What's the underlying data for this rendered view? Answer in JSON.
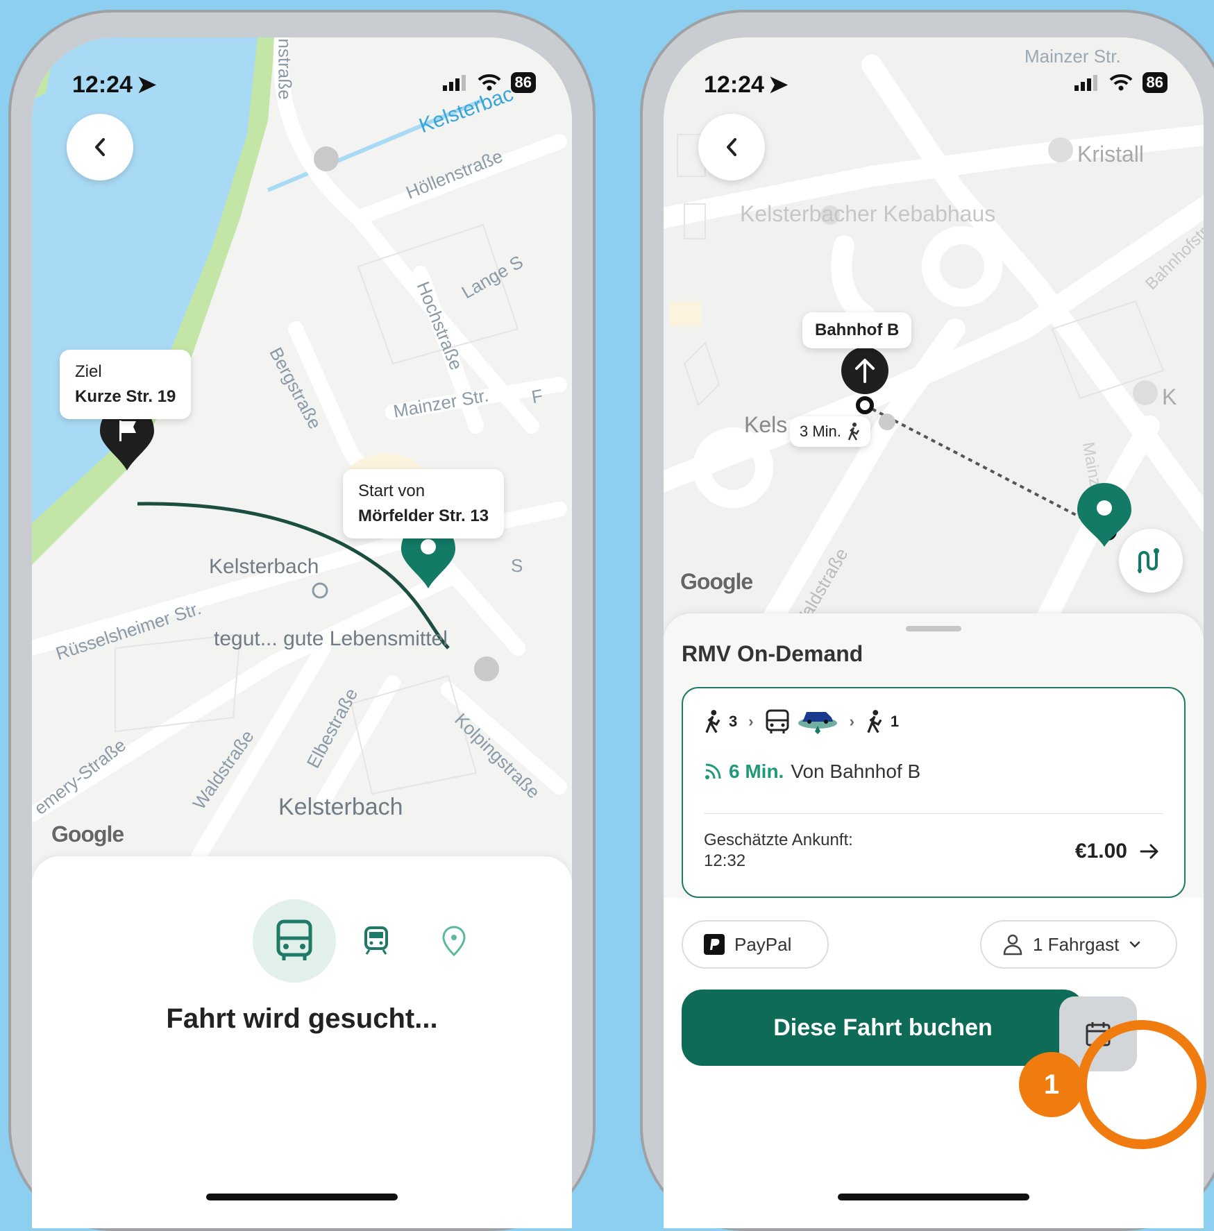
{
  "status": {
    "time": "12:24",
    "battery": "86"
  },
  "screen1": {
    "map_labels": {
      "kelsterbach_top": "Kelsterbac",
      "hollenstrasse": "Höllenstraße",
      "strasse_top": "nstraße",
      "lange": "Lange S",
      "hochstrasse": "Hochstraße",
      "bergstrasse": "Bergstraße",
      "mainzer": "Mainzer Str.",
      "kelsterbach_station": "Kelsterbach",
      "russelsheimer": "Rüsselsheimer Str.",
      "tegut": "tegut... gute Lebensmittel",
      "emery": "emery-Straße",
      "waldstrasse": "Waldstraße",
      "elbestrasse": "Elbestraße",
      "kolpingstrasse": "Kolpingstraße",
      "kelsterbach_city": "Kelsterbach",
      "s_suffix": "S",
      "f_suffix": "F"
    },
    "destination": {
      "label": "Ziel",
      "address": "Kurze Str. 19"
    },
    "origin": {
      "label": "Start von",
      "address": "Mörfelder Str. 13"
    },
    "google": "Google",
    "searching_text": "Fahrt wird gesucht..."
  },
  "screen2": {
    "map_labels": {
      "mainzer": "Mainzer Str.",
      "kristall": "Kristall",
      "kebabhaus": "Kelsterbacher Kebabhaus",
      "bahnhofstr": "Bahnhofstra",
      "kels": "Kels",
      "k": "K",
      "waldstrasse": "Waldstraße",
      "stre": "Mainzer Str"
    },
    "stop_label": "Bahnhof B",
    "walk_time": "3 Min.",
    "google": "Google",
    "service_title": "RMV On-Demand",
    "legs": {
      "walk_start": "3",
      "walk_end": "1"
    },
    "eta_minutes": "6 Min.",
    "eta_from": "Von Bahnhof B",
    "arrival_label": "Geschätzte Ankunft:",
    "arrival_time": "12:32",
    "price": "€1.00",
    "payment": "PayPal",
    "passengers": "1 Fahrgast",
    "book_button": "Diese Fahrt buchen",
    "step_badge": "1"
  },
  "colors": {
    "accent": "#0e6b58",
    "highlight": "#f07c10",
    "background": "#8ccff0"
  }
}
